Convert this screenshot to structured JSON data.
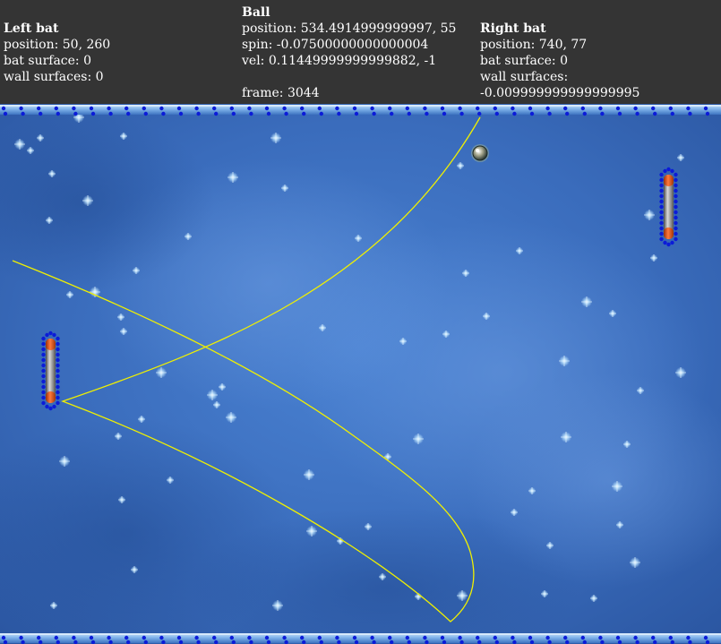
{
  "left_bat": {
    "title": "Left bat",
    "position": "position: 50, 260",
    "bat_surface": "bat surface: 0",
    "wall_surfaces": "wall surfaces: 0"
  },
  "ball": {
    "title": "Ball",
    "position": "position: 534.4914999999997, 55",
    "spin": "spin: -0.07500000000000004",
    "vel": "vel: 0.11449999999999882, -1",
    "frame": "frame: 3044"
  },
  "right_bat": {
    "title": "Right bat",
    "position": "position: 740, 77",
    "bat_surface": "bat surface: 0",
    "wall_surfaces": "wall surfaces: -0.009999999999999995"
  },
  "colors": {
    "hud_background": "#343434",
    "field_blue": "#3a6fc0",
    "trajectory": "#f0f000",
    "collision_dots": "#0b1bd8",
    "bat_cap": "#e0531f",
    "wall_bar": "#6fa6e3"
  }
}
